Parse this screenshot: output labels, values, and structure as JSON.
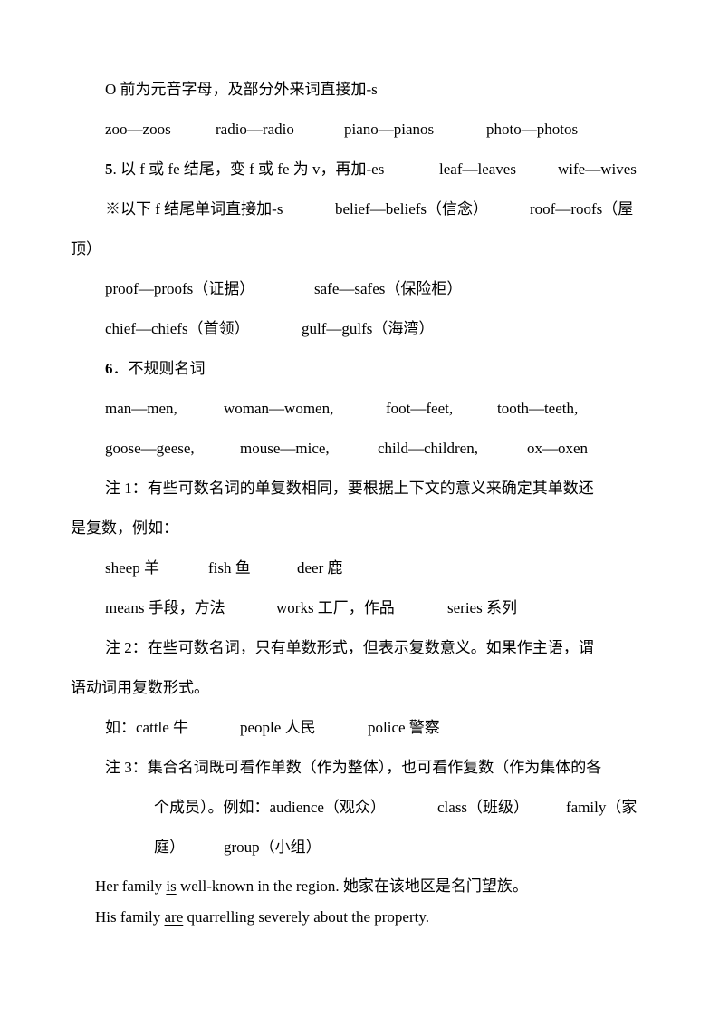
{
  "page": {
    "rule_o": "O 前为元音字母，及部分外来词直接加-s",
    "o_examples": [
      "zoo—zoos",
      "radio—radio",
      "piano—pianos",
      "photo—photos"
    ],
    "rule5": {
      "number": "5",
      "text": ". 以 f 或 fe 结尾，变 f 或 fe 为 v，再加-es",
      "examples": [
        "leaf—leaves",
        "wife—wives"
      ]
    },
    "exception_f": {
      "text": "※以下 f 结尾单词直接加-s",
      "examples": [
        "belief—beliefs（信念）",
        "roof—roofs（屋"
      ],
      "wrap": "顶）"
    },
    "f_examples_row1": [
      "proof—proofs（证据）",
      "safe—safes（保险柜）"
    ],
    "f_examples_row2": [
      "chief—chiefs（首领）",
      "gulf—gulfs（海湾）"
    ],
    "rule6": {
      "number": "6",
      "text": "．不规则名词"
    },
    "irregular_row1": [
      "man—men,",
      "woman—women,",
      "foot—feet,",
      "tooth—teeth,"
    ],
    "irregular_row2": [
      "goose—geese,",
      "mouse—mice,",
      "child—children,",
      "ox—oxen"
    ],
    "note1": {
      "line1": "注 1：有些可数名词的单复数相同，要根据上下文的意义来确定其单数还",
      "line2": "是复数，例如：",
      "examples_row1": [
        "sheep  羊",
        "fish  鱼",
        "deer  鹿"
      ],
      "examples_row2": [
        "means 手段，方法",
        "works 工厂，作品",
        "series 系列"
      ]
    },
    "note2": {
      "line1": "注 2：在些可数名词，只有单数形式，但表示复数意义。如果作主语，谓",
      "line2": "语动词用复数形式。",
      "examples": [
        "如：cattle  牛",
        "people  人民",
        "police  警察"
      ]
    },
    "note3": {
      "line1": "注 3：集合名词既可看作单数（作为整体），也可看作复数（作为集体的各",
      "line2_parts": [
        "个成员）。例如：audience（观众）",
        "class（班级）",
        "family（家"
      ],
      "line3_parts": [
        "庭）",
        "group（小组）"
      ]
    },
    "sentence1": {
      "before": "Her family ",
      "verb": "is",
      "after": " well-known in the region.  她家在该地区是名门望族。"
    },
    "sentence2": {
      "before": "His family ",
      "verb": "are",
      "after": " quarrelling severely about the property."
    }
  }
}
